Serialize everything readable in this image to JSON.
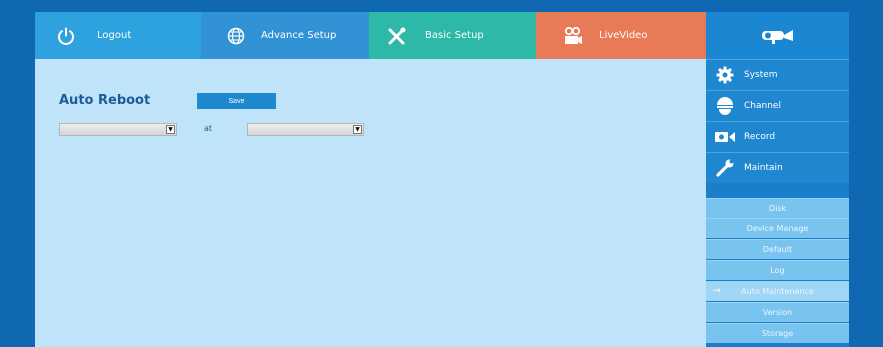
{
  "nav": {
    "tabs": [
      {
        "label": "Logout",
        "icon": "power-icon",
        "color": "#2ea2df"
      },
      {
        "label": "Advance Setup",
        "icon": "globe-icon",
        "color": "#3292d6"
      },
      {
        "label": "Basic Setup",
        "icon": "tools-icon",
        "color": "#2db8a7"
      },
      {
        "label": "LiveVideo",
        "icon": "camera-icon",
        "color": "#e97a58"
      },
      {
        "label": "",
        "icon": "cctv-logo-icon",
        "color": "#1b86d2"
      }
    ]
  },
  "main": {
    "title": "Auto Reboot",
    "save_label": "Save",
    "at_label": "at",
    "select1_value": "",
    "select2_value": ""
  },
  "sidebar": {
    "main_items": [
      {
        "label": "System",
        "icon": "gear-icon"
      },
      {
        "label": "Channel",
        "icon": "dome-camera-icon"
      },
      {
        "label": "Record",
        "icon": "video-camera-icon"
      },
      {
        "label": "Maintain",
        "icon": "wrench-icon"
      }
    ],
    "sub_items": [
      {
        "label": "Disk"
      },
      {
        "label": "Device Manage"
      },
      {
        "label": "Default"
      },
      {
        "label": "Log"
      },
      {
        "label": "Auto Maintenance",
        "active": true
      },
      {
        "label": "Version"
      },
      {
        "label": "Storage"
      }
    ],
    "active_arrow": "→"
  },
  "colors": {
    "page_bg": "#1068b3",
    "content_bg": "#bfe4f9",
    "accent": "#1e89cf",
    "title": "#1c5a9c"
  }
}
